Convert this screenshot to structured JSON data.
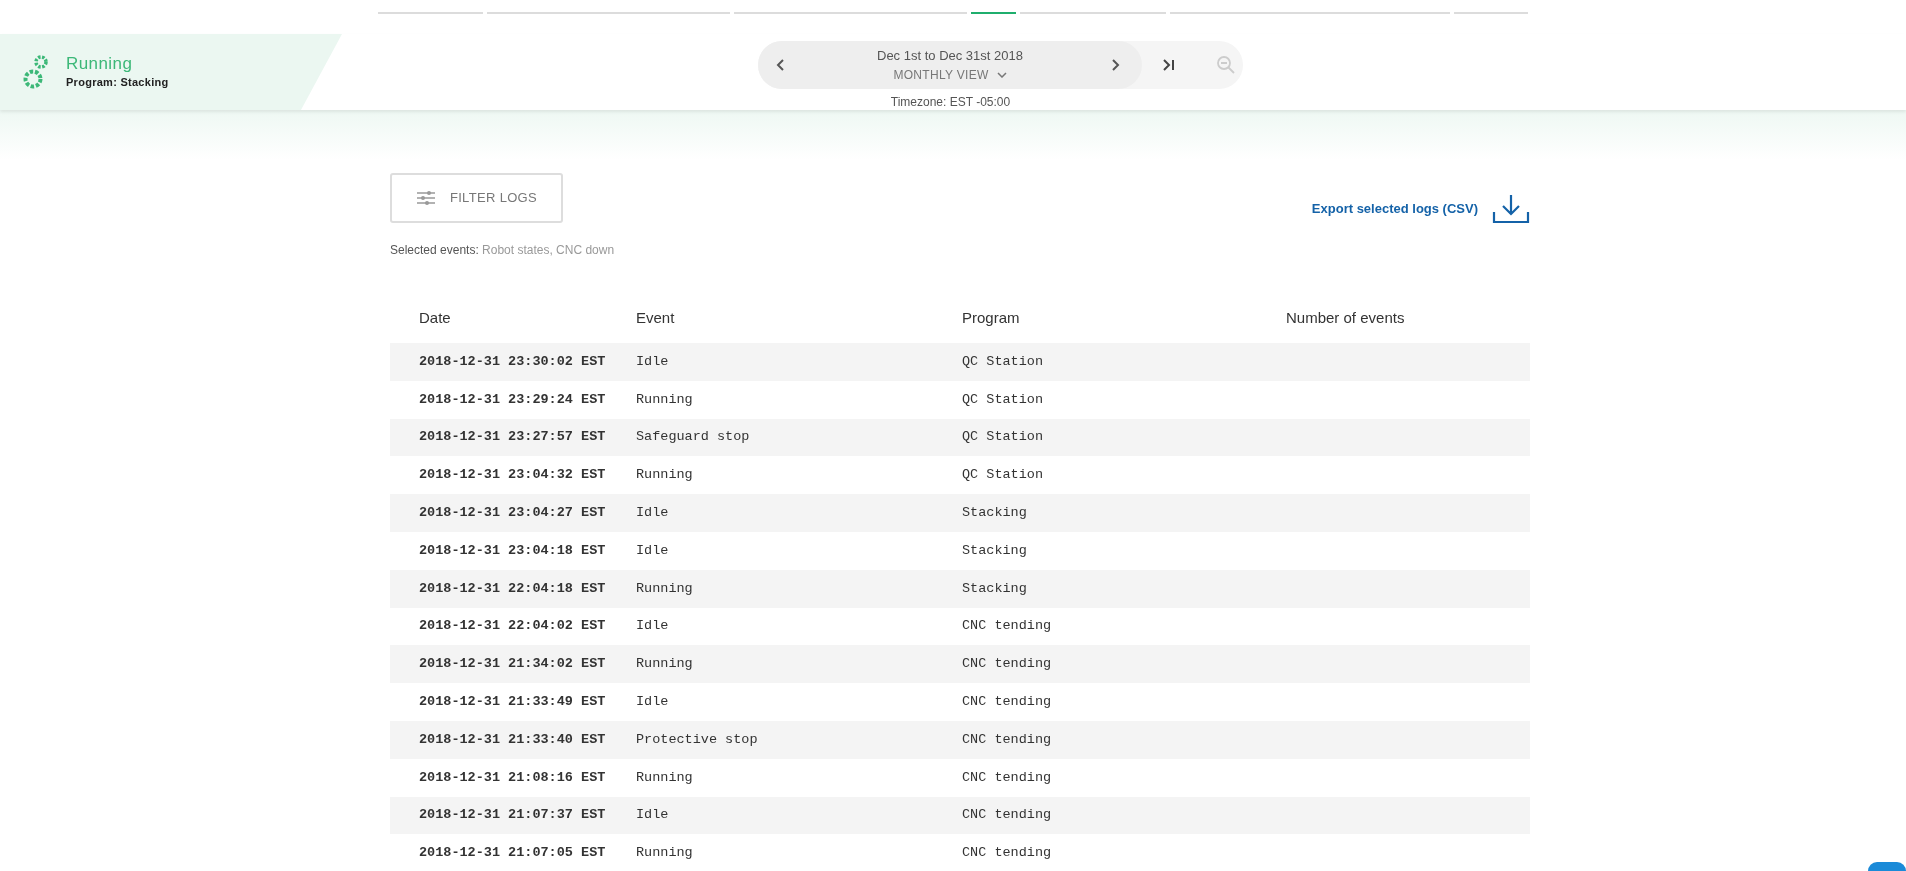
{
  "top_tabs": [
    {
      "selected": false
    },
    {
      "selected": false
    },
    {
      "selected": false
    },
    {
      "selected": true
    },
    {
      "selected": false
    },
    {
      "selected": false
    },
    {
      "selected": false
    }
  ],
  "robot_status": {
    "state": "Running",
    "program": "Program: Stacking"
  },
  "date_range": {
    "label": "Dec 1st to Dec 31st 2018",
    "view": "MONTHLY VIEW",
    "timezone": "Timezone: EST -05:00"
  },
  "filter_button": "FILTER LOGS",
  "selected_events": {
    "label": "Selected events:",
    "value": "Robot states, CNC down"
  },
  "export_link": "Export selected logs (CSV)",
  "table": {
    "columns": [
      "Date",
      "Event",
      "Program",
      "Number of events"
    ],
    "rows": [
      [
        "2018-12-31 23:30:02 EST",
        "Idle",
        "QC Station"
      ],
      [
        "2018-12-31 23:29:24 EST",
        "Running",
        "QC Station"
      ],
      [
        "2018-12-31 23:27:57 EST",
        "Safeguard stop",
        "QC Station"
      ],
      [
        "2018-12-31 23:04:32 EST",
        "Running",
        "QC Station"
      ],
      [
        "2018-12-31 23:04:27 EST",
        "Idle",
        "Stacking"
      ],
      [
        "2018-12-31 23:04:18 EST",
        "Idle",
        "Stacking"
      ],
      [
        "2018-12-31 22:04:18 EST",
        "Running",
        "Stacking"
      ],
      [
        "2018-12-31 22:04:02 EST",
        "Idle",
        "CNC tending"
      ],
      [
        "2018-12-31 21:34:02 EST",
        "Running",
        "CNC tending"
      ],
      [
        "2018-12-31 21:33:49 EST",
        "Idle",
        "CNC tending"
      ],
      [
        "2018-12-31 21:33:40 EST",
        "Protective stop",
        "CNC tending"
      ],
      [
        "2018-12-31 21:08:16 EST",
        "Running",
        "CNC tending"
      ],
      [
        "2018-12-31 21:07:37 EST",
        "Idle",
        "CNC tending"
      ],
      [
        "2018-12-31 21:07:05 EST",
        "Running",
        "CNC tending"
      ]
    ]
  }
}
